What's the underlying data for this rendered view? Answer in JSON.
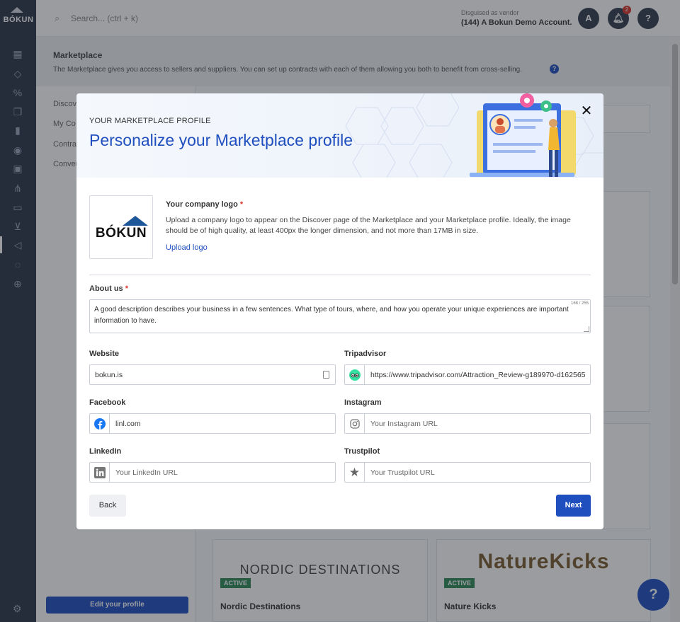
{
  "app": {
    "logo_text": "BÓKUN"
  },
  "topbar": {
    "search_placeholder": "Search... (ctrl + k)",
    "disguised_label": "Disguised as vendor",
    "vendor_name": "(144) A Bokun Demo Account.",
    "avatar_letter": "A",
    "notification_count": "2",
    "help_label": "?"
  },
  "sidebar": {
    "icons": [
      "calendar-icon",
      "tag-icon",
      "percent-icon",
      "copy-icon",
      "bar-chart-icon",
      "user-circle-icon",
      "grid-icon",
      "sitemap-icon",
      "laptop-icon",
      "cart-icon",
      "megaphone-icon",
      "chat-icon",
      "globe-icon"
    ],
    "settings_icon": "gear-icon"
  },
  "background": {
    "title": "Marketplace",
    "description": "The Marketplace gives you access to sellers and suppliers. You can set up contracts with each of them allowing you both to benefit from cross-selling.",
    "nav": [
      "Discov",
      "My Co",
      "Contra",
      "Conver"
    ],
    "edit_profile": "Edit your profile",
    "cards": [
      {
        "logo": "NORDIC DESTINATIONS",
        "badge": "ACTIVE",
        "name": "Nordic Destinations"
      },
      {
        "logo": "NatureKicks",
        "badge": "ACTIVE",
        "name": "Nature Kicks"
      }
    ],
    "help_fab": "?"
  },
  "modal": {
    "eyebrow": "YOUR MARKETPLACE PROFILE",
    "title": "Personalize your Marketplace profile",
    "logo_section": {
      "label": "Your company logo",
      "required_mark": "*",
      "logo_text": "BÓKUN",
      "description": "Upload a company logo to appear on the Discover page of the Marketplace and your Marketplace profile. Ideally, the image should be of high quality, at least 400px the longer dimension, and not more than 17MB in size.",
      "upload_link": "Upload logo"
    },
    "about": {
      "label": "About us",
      "required_mark": "*",
      "value": "A good description describes your business in a few sentences. What type of tours, where, and how you operate your unique experiences are important information to have.",
      "counter": "168 / 255"
    },
    "website": {
      "label": "Website",
      "value": "bokun.is"
    },
    "tripadvisor": {
      "label": "Tripadvisor",
      "value": "https://www.tripadvisor.com/Attraction_Review-g189970-d162565"
    },
    "facebook": {
      "label": "Facebook",
      "value": "linl.com"
    },
    "instagram": {
      "label": "Instagram",
      "placeholder": "Your Instagram URL"
    },
    "linkedin": {
      "label": "LinkedIn",
      "placeholder": "Your LinkedIn URL"
    },
    "trustpilot": {
      "label": "Trustpilot",
      "placeholder": "Your Trustpilot URL"
    },
    "back_label": "Back",
    "next_label": "Next",
    "colors": {
      "primary": "#1f4fbf",
      "required": "#d9342b"
    }
  }
}
